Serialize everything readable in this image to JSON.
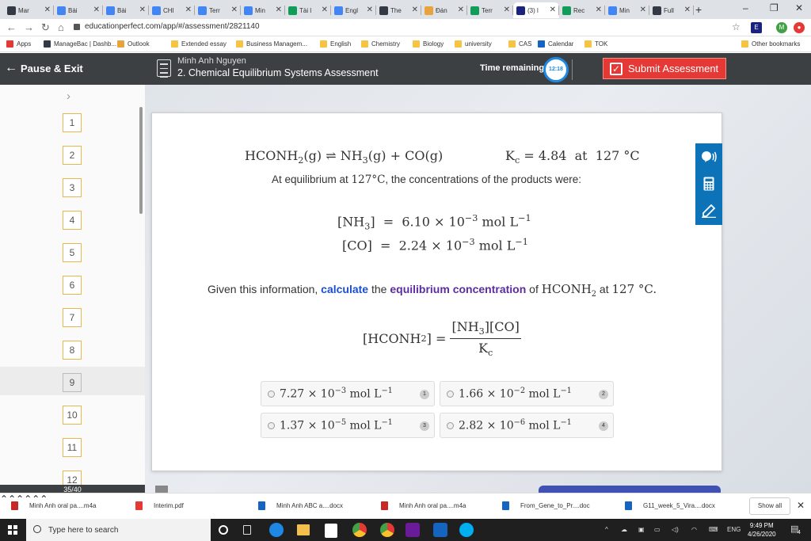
{
  "browser": {
    "tabs": [
      {
        "label": "Mar",
        "color": "#333a45"
      },
      {
        "label": "Bài",
        "color": "#4285f4"
      },
      {
        "label": "Bài",
        "color": "#4285f4"
      },
      {
        "label": "CHI",
        "color": "#4285f4"
      },
      {
        "label": "Terr",
        "color": "#4285f4"
      },
      {
        "label": "Min",
        "color": "#4285f4"
      },
      {
        "label": "Tài l",
        "color": "#0f9d58"
      },
      {
        "label": "Engl",
        "color": "#4285f4"
      },
      {
        "label": "The",
        "color": "#333a45"
      },
      {
        "label": "Đán",
        "color": "#e8a33d"
      },
      {
        "label": "Terr",
        "color": "#0f9d58"
      },
      {
        "label": "(3) l",
        "color": "#1a237e"
      },
      {
        "label": "Rec",
        "color": "#0f9d58"
      },
      {
        "label": "Min",
        "color": "#4285f4"
      },
      {
        "label": "Full",
        "color": "#333a45"
      }
    ],
    "new_tab": "+",
    "window_controls": [
      "–",
      "❐",
      "✕"
    ],
    "url": "educationperfect.com/app/#/assessment/2821140",
    "profile_initial": "M",
    "bookmarks": [
      {
        "label": "Apps",
        "color": "#e53935"
      },
      {
        "label": "ManageBac | Dashb...",
        "color": "#333a45"
      },
      {
        "label": "Outlook",
        "color": "#e8a33d"
      },
      {
        "label": "Extended essay",
        "color": "#f6c343"
      },
      {
        "label": "Business Managem...",
        "color": "#f6c343"
      },
      {
        "label": "English",
        "color": "#f6c343"
      },
      {
        "label": "Chemistry",
        "color": "#f6c343"
      },
      {
        "label": "Biology",
        "color": "#f6c343"
      },
      {
        "label": "university",
        "color": "#f6c343"
      },
      {
        "label": "CAS",
        "color": "#f6c343"
      },
      {
        "label": "Calendar",
        "color": "#1565c0"
      },
      {
        "label": "TOK",
        "color": "#f6c343"
      }
    ],
    "other_bookmarks": "Other bookmarks"
  },
  "header": {
    "pause_label": "Pause & Exit",
    "user_name": "Minh Anh Nguyen",
    "assessment_title": "2. Chemical Equilibrium Systems Assessment",
    "time_label": "Time remaining:",
    "time_value": "12:18",
    "submit_label": "Submit Assessment"
  },
  "question_nav": {
    "numbers": [
      "1",
      "2",
      "3",
      "4",
      "5",
      "6",
      "7",
      "8",
      "9",
      "10",
      "11",
      "12"
    ],
    "current": "9",
    "progress": "35/40"
  },
  "question": {
    "reaction": {
      "reactant": "HCONH",
      "reactant_sub": "2",
      "reactant_state": "(g)",
      "arrow": "⇌",
      "p1": "NH",
      "p1_sub": "3",
      "p1_state": "(g)",
      "plus": "+",
      "p2": "CO(g)",
      "kc_label": "K",
      "kc_sub": "c",
      "kc_value": "= 4.84",
      "kc_at": "at",
      "kc_temp": "127 °C"
    },
    "intro_text_1": "At equilibrium at ",
    "intro_temp": "127°C",
    "intro_text_2": ", the concentrations of the products were:",
    "conc_nh3": {
      "species": "[NH",
      "sub": "3",
      "close": "]",
      "eq": "=",
      "value": "6.10 × 10",
      "exp": "−3",
      "unit": "mol L",
      "unit_exp": "−1"
    },
    "conc_co": {
      "species": "[CO]",
      "eq": "=",
      "value": "2.24 × 10",
      "exp": "−3",
      "unit": "mol L",
      "unit_exp": "−1"
    },
    "prompt_pre": "Given this information, ",
    "prompt_kw1": "calculate",
    "prompt_mid": " the ",
    "prompt_kw2": "equilibrium concentration",
    "prompt_of": " of ",
    "prompt_species": "HCONH",
    "prompt_species_sub": "2",
    "prompt_at": " at ",
    "prompt_temp": "127 °C.",
    "formula": {
      "lhs": "[HCONH",
      "lhs_sub": "2",
      "lhs_close": "] =",
      "num": "[NH",
      "num_sub": "3",
      "num_rest": "][CO]",
      "den": "K",
      "den_sub": "c"
    }
  },
  "options": [
    {
      "mantissa": "7.27 × 10",
      "exp": "−3",
      "unit": "mol L",
      "unit_exp": "−1",
      "badge": "1"
    },
    {
      "mantissa": "1.66 × 10",
      "exp": "−2",
      "unit": "mol L",
      "unit_exp": "−1",
      "badge": "2"
    },
    {
      "mantissa": "1.37 × 10",
      "exp": "−5",
      "unit": "mol L",
      "unit_exp": "−1",
      "badge": "3"
    },
    {
      "mantissa": "2.82 × 10",
      "exp": "−6",
      "unit": "mol L",
      "unit_exp": "−1",
      "badge": "4"
    }
  ],
  "tools": [
    "speaker-icon",
    "calculator-icon",
    "pen-icon"
  ],
  "downloads": [
    {
      "label": "Minh Anh oral pa....m4a",
      "color": "#c62828"
    },
    {
      "label": "Interim.pdf",
      "color": "#e53935"
    },
    {
      "label": "Minh Anh ABC a....docx",
      "color": "#1565c0"
    },
    {
      "label": "Minh Anh oral pa....m4a",
      "color": "#c62828"
    },
    {
      "label": "From_Gene_to_Pr....doc",
      "color": "#1565c0"
    },
    {
      "label": "G11_week_5_Vira....docx",
      "color": "#1565c0"
    }
  ],
  "show_all": "Show all",
  "taskbar": {
    "search_placeholder": "Type here to search",
    "lang": "ENG",
    "time": "9:49 PM",
    "date": "4/26/2020",
    "notif_count": "4"
  }
}
